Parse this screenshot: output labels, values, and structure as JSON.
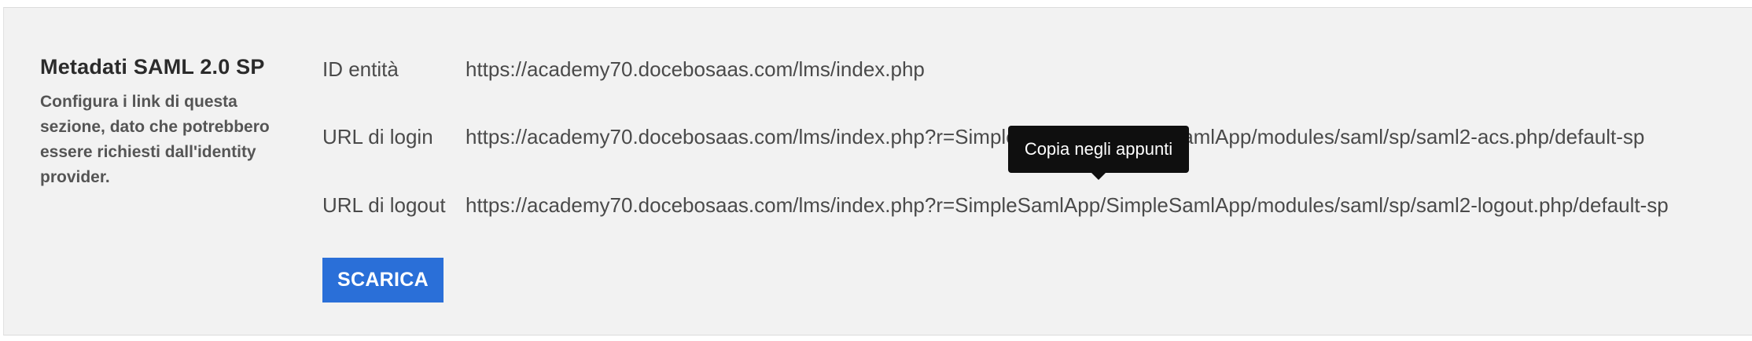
{
  "section": {
    "title": "Metadati SAML 2.0 SP",
    "description": "Configura i link di questa sezione, dato che potrebbero essere richiesti dall'identity provider."
  },
  "rows": [
    {
      "label": "ID entità",
      "value": "https://academy70.docebosaas.com/lms/index.php"
    },
    {
      "label": "URL di login",
      "value": "https://academy70.docebosaas.com/lms/index.php?r=SimpleSamlApp/SimpleSamlApp/modules/saml/sp/saml2-acs.php/default-sp"
    },
    {
      "label": "URL di logout",
      "value": "https://academy70.docebosaas.com/lms/index.php?r=SimpleSamlApp/SimpleSamlApp/modules/saml/sp/saml2-logout.php/default-sp"
    }
  ],
  "download_button": {
    "label": "SCARICA"
  },
  "tooltip": {
    "text": "Copia negli appunti"
  },
  "colors": {
    "panel_background": "#f2f2f2",
    "button_background": "#2a6fd8",
    "tooltip_background": "#0f0f0f",
    "text": "#4a4a4a"
  }
}
